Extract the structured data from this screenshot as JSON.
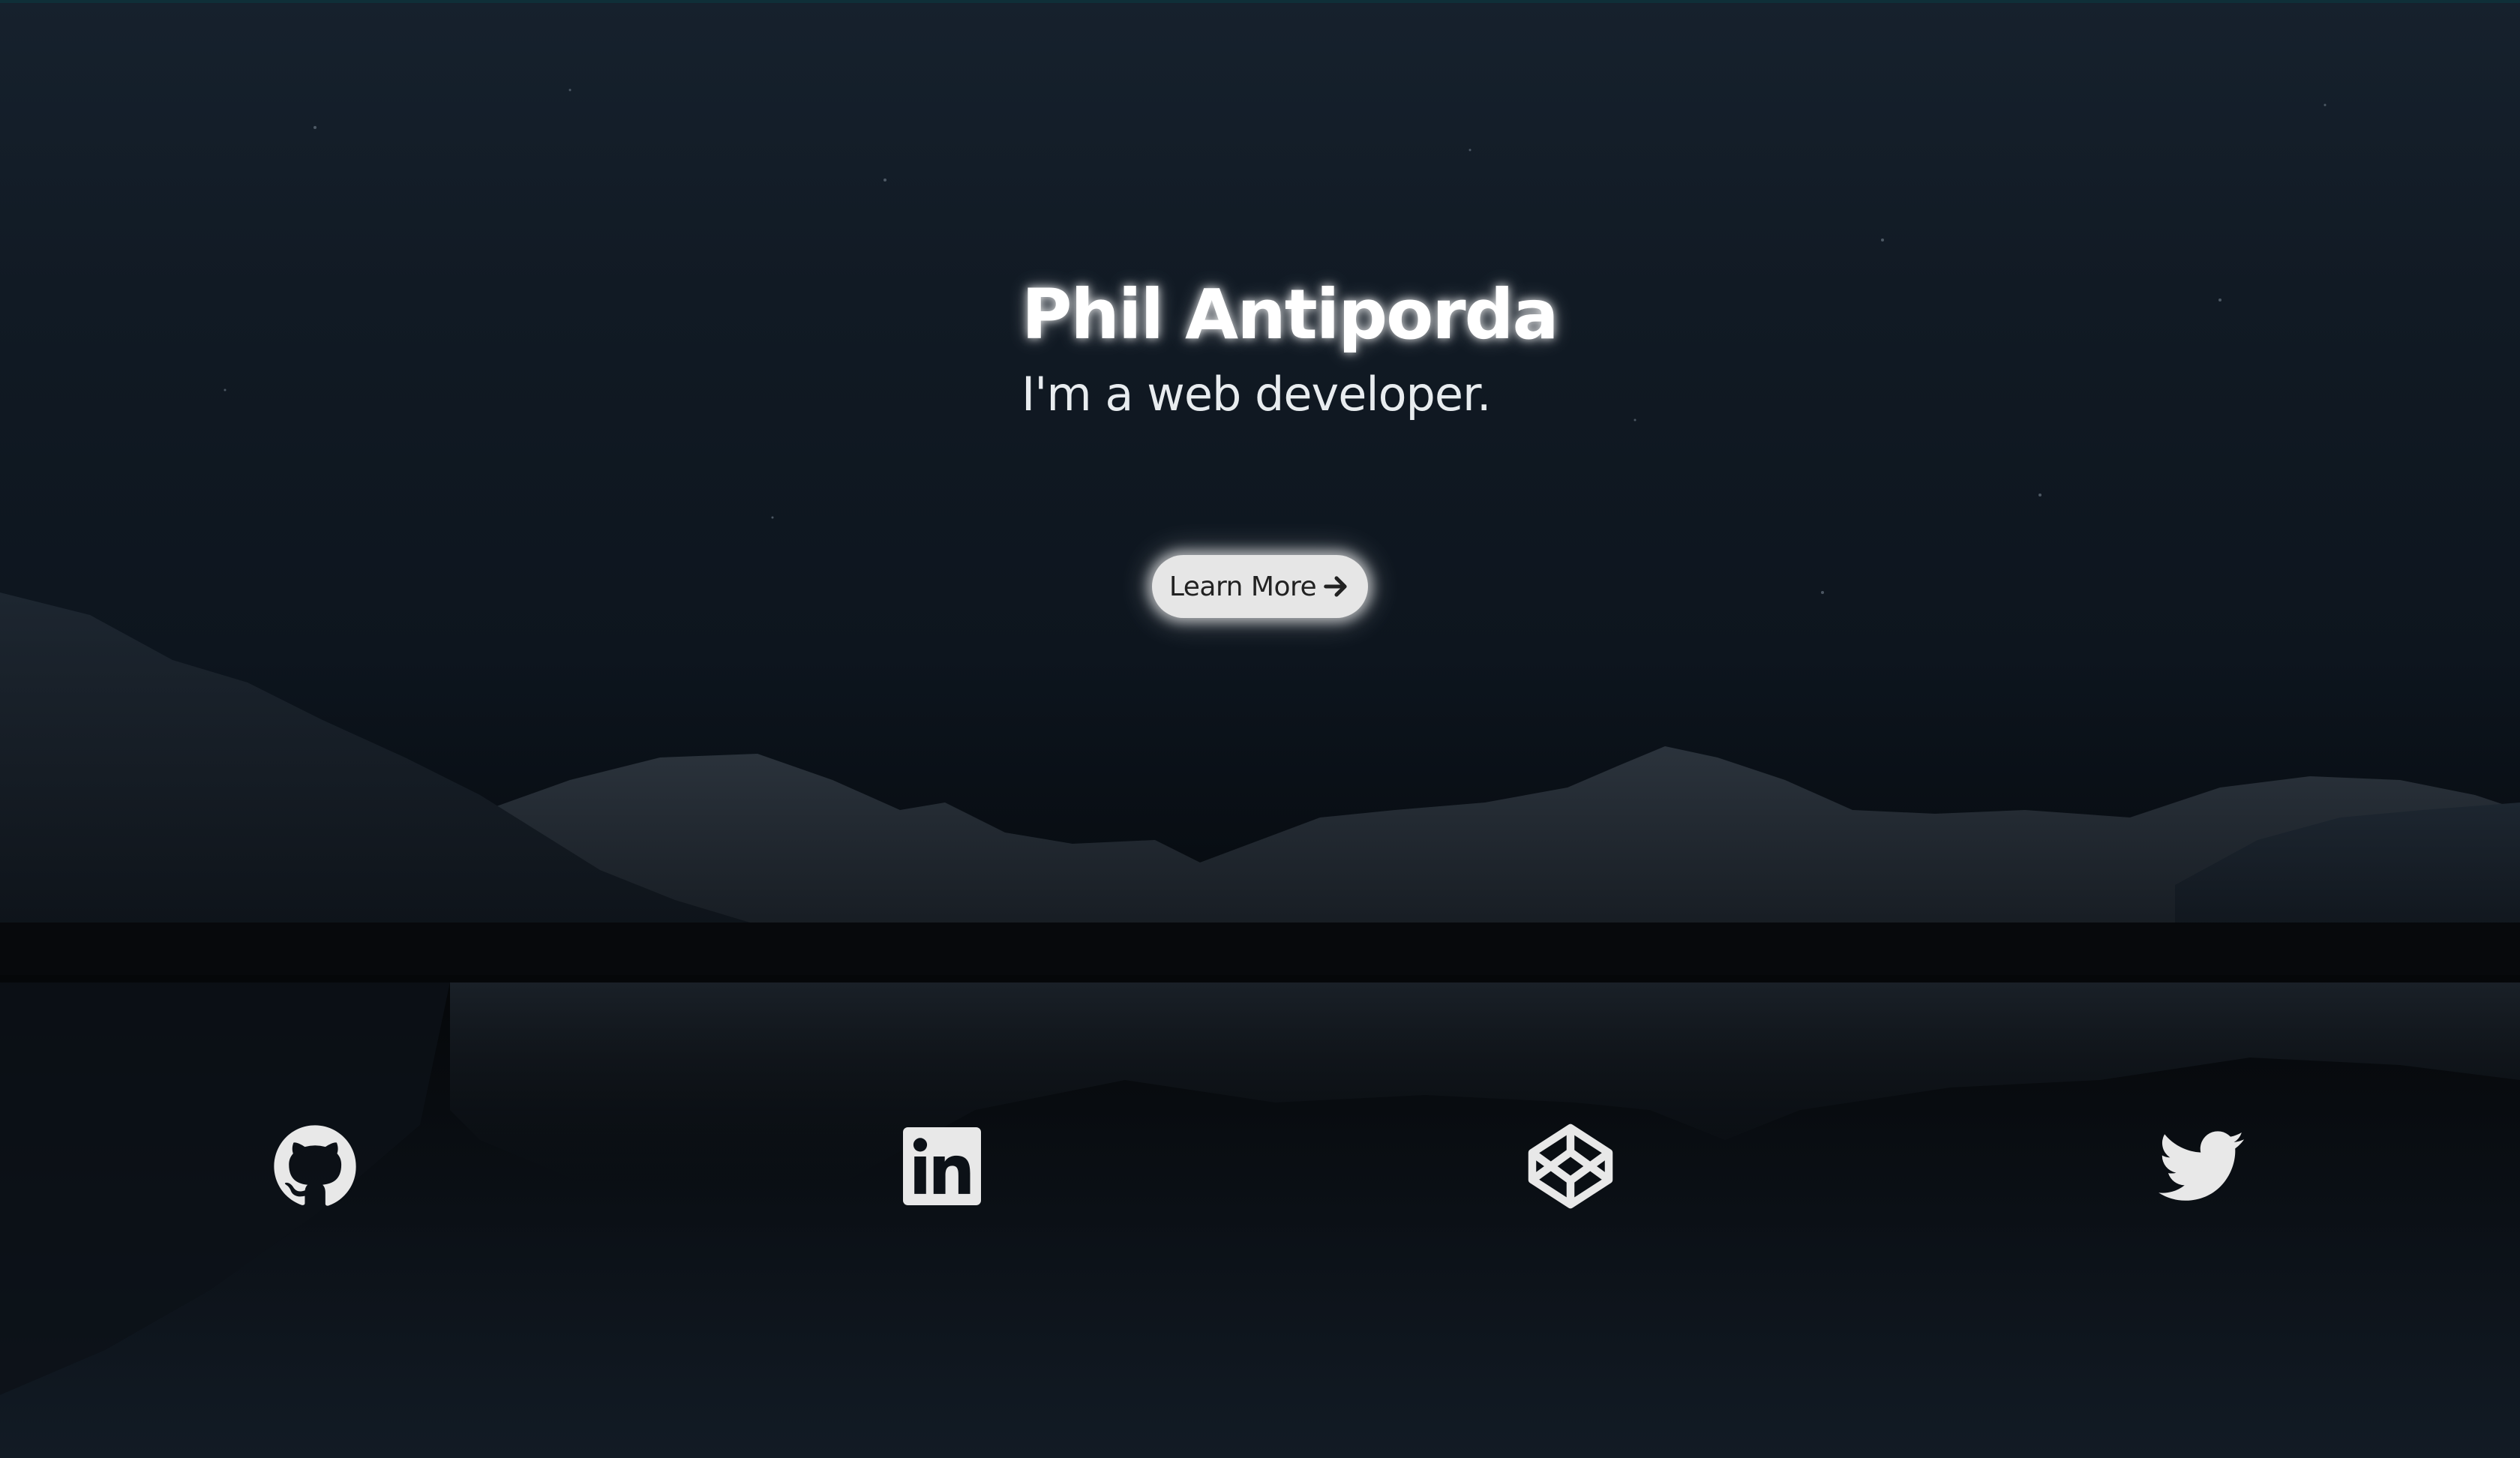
{
  "hero": {
    "title": "Phil Antiporda",
    "subtitle": "I'm a web developer.",
    "cta_label": "Learn More",
    "cta_icon": "arrow-right-icon"
  },
  "socials": [
    {
      "name": "GitHub",
      "icon": "github-icon"
    },
    {
      "name": "LinkedIn",
      "icon": "linkedin-icon"
    },
    {
      "name": "CodePen",
      "icon": "codepen-icon"
    },
    {
      "name": "Twitter",
      "icon": "twitter-icon"
    }
  ],
  "colors": {
    "background_dark": "#0b121a",
    "text": "#ffffff",
    "button_bg": "#e6e6e6",
    "button_text": "#222222",
    "icon": "#e8e8e8"
  }
}
